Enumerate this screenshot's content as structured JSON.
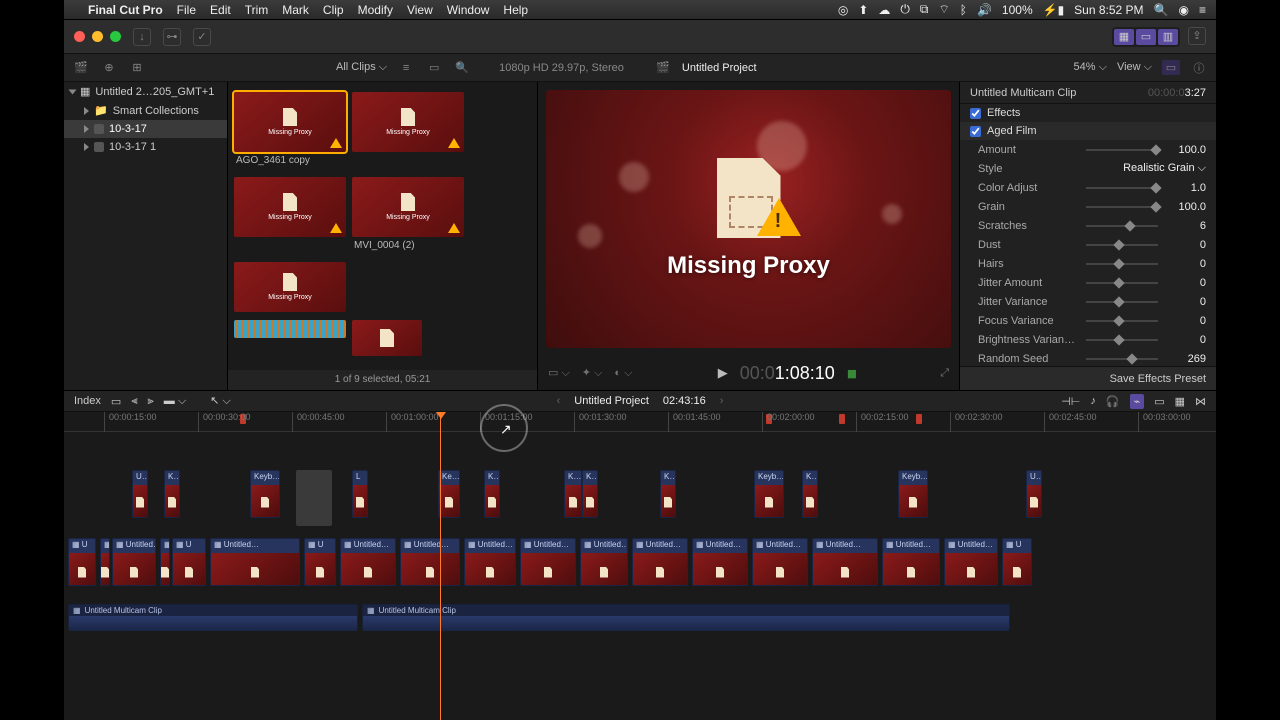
{
  "menubar": {
    "app": "Final Cut Pro",
    "items": [
      "File",
      "Edit",
      "Trim",
      "Mark",
      "Clip",
      "Modify",
      "View",
      "Window",
      "Help"
    ],
    "battery": "100%",
    "clock": "Sun 8:52 PM"
  },
  "toolbar": {},
  "optbar": {
    "clips_filter": "All Clips",
    "format_info": "1080p HD 29.97p, Stereo",
    "project_name": "Untitled Project",
    "zoom": "54%",
    "view_label": "View"
  },
  "sidebar": {
    "library": "Untitled 2…205_GMT+1",
    "items": [
      {
        "label": "Smart Collections",
        "sel": false
      },
      {
        "label": "10-3-17",
        "sel": true
      },
      {
        "label": "10-3-17 1",
        "sel": false
      }
    ]
  },
  "browser": {
    "clips": [
      {
        "name": "AGO_3461 copy"
      },
      {
        "name": ""
      },
      {
        "name": ""
      },
      {
        "name": "MVI_0004 (2)"
      }
    ],
    "proxy_label": "Missing Proxy",
    "footer": "1 of 9 selected, 05:21"
  },
  "viewer": {
    "missing_proxy": "Missing Proxy",
    "timecode_gray": "00:0",
    "timecode_white": "1:08:10"
  },
  "inspector": {
    "clip_name": "Untitled Multicam Clip",
    "clip_dur_g": "00:00:0",
    "clip_dur": "3:27",
    "effects_label": "Effects",
    "effect_name": "Aged Film",
    "style_label": "Style",
    "style_value": "Realistic Grain",
    "params": [
      {
        "label": "Amount",
        "val": "100.0",
        "pos": 92
      },
      {
        "label": "Color Adjust",
        "val": "1.0",
        "pos": 92
      },
      {
        "label": "Grain",
        "val": "100.0",
        "pos": 92
      },
      {
        "label": "Scratches",
        "val": "6",
        "pos": 55
      },
      {
        "label": "Dust",
        "val": "0",
        "pos": 40
      },
      {
        "label": "Hairs",
        "val": "0",
        "pos": 40
      },
      {
        "label": "Jitter Amount",
        "val": "0",
        "pos": 40
      },
      {
        "label": "Jitter Variance",
        "val": "0",
        "pos": 40
      },
      {
        "label": "Focus Variance",
        "val": "0",
        "pos": 40
      },
      {
        "label": "Brightness Varian…",
        "val": "0",
        "pos": 40
      },
      {
        "label": "Random Seed",
        "val": "269",
        "pos": 58
      }
    ],
    "save_preset": "Save Effects Preset"
  },
  "timeline_bar": {
    "index": "Index",
    "project": "Untitled Project",
    "duration": "02:43:16"
  },
  "ruler": {
    "ticks": [
      "00:00:15:00",
      "00:00:30:00",
      "00:00:45:00",
      "00:01:00:00",
      "00:01:15:00",
      "00:01:30:00",
      "00:01:45:00",
      "00:02:00:00",
      "00:02:15:00",
      "00:02:30:00",
      "00:02:45:00",
      "00:03:00:00"
    ]
  },
  "tl_clips": {
    "upper_labels": [
      "U…",
      "K…",
      "Keyb…",
      "L",
      "Ke…",
      "K…",
      "K…",
      "K…",
      "K…",
      "Keyb…",
      "K…",
      "Keyb…",
      "U…"
    ],
    "main_label": "Untitled…",
    "audio_label": "Untitled Multicam Clip"
  }
}
